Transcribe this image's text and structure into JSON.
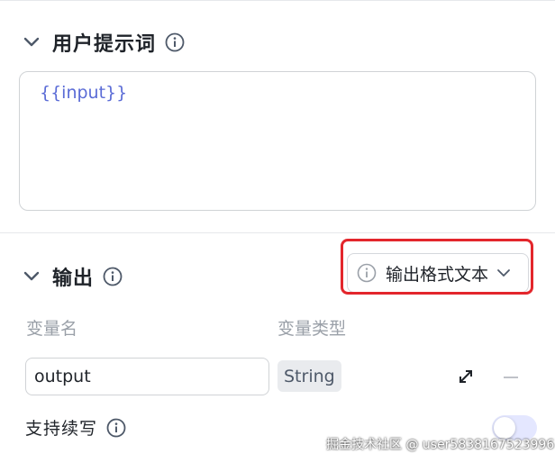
{
  "user_prompt": {
    "title": "用户提示词",
    "value": "{{input}}"
  },
  "output": {
    "title": "输出",
    "format_select": {
      "selected": "输出格式文本"
    },
    "columns": {
      "name": "变量名",
      "type": "变量类型"
    },
    "row": {
      "name_value": "output",
      "type": "String"
    },
    "support_continue": {
      "label": "支持续写",
      "enabled": false
    }
  },
  "watermark": "掘金技术社区 @ user5838167523996",
  "colors": {
    "highlight": "#e3262c",
    "accent": "#5a6bd6",
    "toggle_off": "#e4e7ff"
  },
  "icons": [
    "chevron-down-icon",
    "info-icon",
    "expand-icon",
    "minus-icon"
  ]
}
